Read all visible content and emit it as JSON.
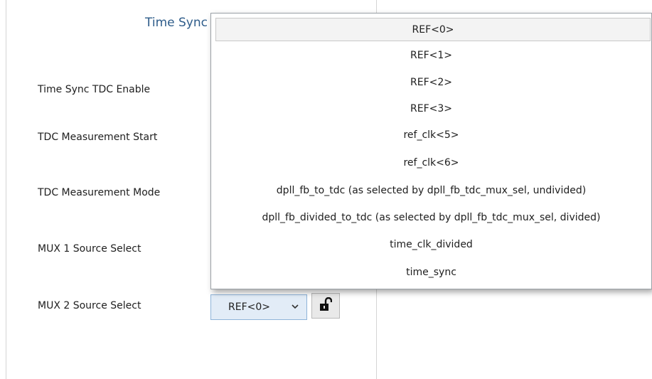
{
  "panel": {
    "title": "Time Sync",
    "labels": [
      "Time Sync TDC Enable",
      "TDC Measurement Start",
      "TDC Measurement Mode",
      "MUX 1 Source Select",
      "MUX 2 Source Select"
    ]
  },
  "mux2": {
    "selected_value": "REF<0>",
    "dropdown_icon": "chevron-down-icon",
    "lock_icon": "unlocked-padlock-icon"
  },
  "dropdown": {
    "options": [
      "REF<0>",
      "REF<1>",
      "REF<2>",
      "REF<3>",
      "ref_clk<5>",
      "ref_clk<6>",
      "dpll_fb_to_tdc (as selected by dpll_fb_tdc_mux_sel, undivided)",
      "dpll_fb_divided_to_tdc (as selected by dpll_fb_tdc_mux_sel, divided)",
      "time_clk_divided",
      "time_sync"
    ],
    "highlighted_index": 0
  },
  "colors": {
    "title": "#2e5c8a",
    "combo_background": "#e2ecf7",
    "combo_border": "#8fb4d9",
    "highlight": "#f3f3f3"
  }
}
